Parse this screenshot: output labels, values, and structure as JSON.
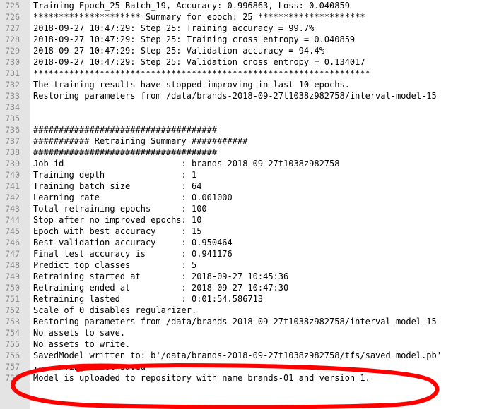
{
  "lines": [
    {
      "num": "725",
      "text": "Training Epoch_25 Batch_19, Accuracy: 0.996863, Loss: 0.040859"
    },
    {
      "num": "726",
      "text": "********************* Summary for epoch: 25 *********************"
    },
    {
      "num": "727",
      "text": "2018-09-27 10:47:29: Step 25: Training accuracy = 99.7%"
    },
    {
      "num": "728",
      "text": "2018-09-27 10:47:29: Step 25: Training cross entropy = 0.040859"
    },
    {
      "num": "729",
      "text": "2018-09-27 10:47:29: Step 25: Validation accuracy = 94.4%"
    },
    {
      "num": "730",
      "text": "2018-09-27 10:47:29: Step 25: Validation cross entropy = 0.134017"
    },
    {
      "num": "731",
      "text": "******************************************************************"
    },
    {
      "num": "732",
      "text": "The training results have stopped improving in last 10 epochs."
    },
    {
      "num": "733",
      "text": "Restoring parameters from /data/brands-2018-09-27t1038z982758/interval-model-15"
    },
    {
      "num": "734",
      "text": ""
    },
    {
      "num": "735",
      "text": ""
    },
    {
      "num": "736",
      "text": "####################################"
    },
    {
      "num": "737",
      "text": "########### Retraining Summary ###########"
    },
    {
      "num": "738",
      "text": "####################################"
    },
    {
      "num": "739",
      "text": "Job id                       : brands-2018-09-27t1038z982758"
    },
    {
      "num": "740",
      "text": "Training depth               : 1"
    },
    {
      "num": "741",
      "text": "Training batch size          : 64"
    },
    {
      "num": "742",
      "text": "Learning rate                : 0.001000"
    },
    {
      "num": "743",
      "text": "Total retraining epochs      : 100"
    },
    {
      "num": "744",
      "text": "Stop after no improved epochs: 10"
    },
    {
      "num": "745",
      "text": "Epoch with best accuracy     : 15"
    },
    {
      "num": "746",
      "text": "Best validation accuracy     : 0.950464"
    },
    {
      "num": "747",
      "text": "Final test accuracy is       : 0.941176"
    },
    {
      "num": "748",
      "text": "Predict top classes          : 5"
    },
    {
      "num": "749",
      "text": "Retraining started at        : 2018-09-27 10:45:36"
    },
    {
      "num": "750",
      "text": "Retraining ended at          : 2018-09-27 10:47:30"
    },
    {
      "num": "751",
      "text": "Retraining lasted            : 0:01:54.586713"
    },
    {
      "num": "752",
      "text": "Scale of 0 disables regularizer."
    },
    {
      "num": "753",
      "text": "Restoring parameters from /data/brands-2018-09-27t1038z982758/interval-model-15"
    },
    {
      "num": "754",
      "text": "No assets to save."
    },
    {
      "num": "755",
      "text": "No assets to write."
    },
    {
      "num": "756",
      "text": "SavedModel written to: b'/data/brands-2018-09-27t1038z982758/tfs/saved_model.pb'"
    },
    {
      "num": "757",
      "text": "TF serving model saved"
    },
    {
      "num": "758",
      "text": "Model is uploaded to repository with name brands-01 and version 1."
    }
  ],
  "annotation": {
    "color": "#ff0000",
    "shape": "hand-drawn ellipse"
  }
}
